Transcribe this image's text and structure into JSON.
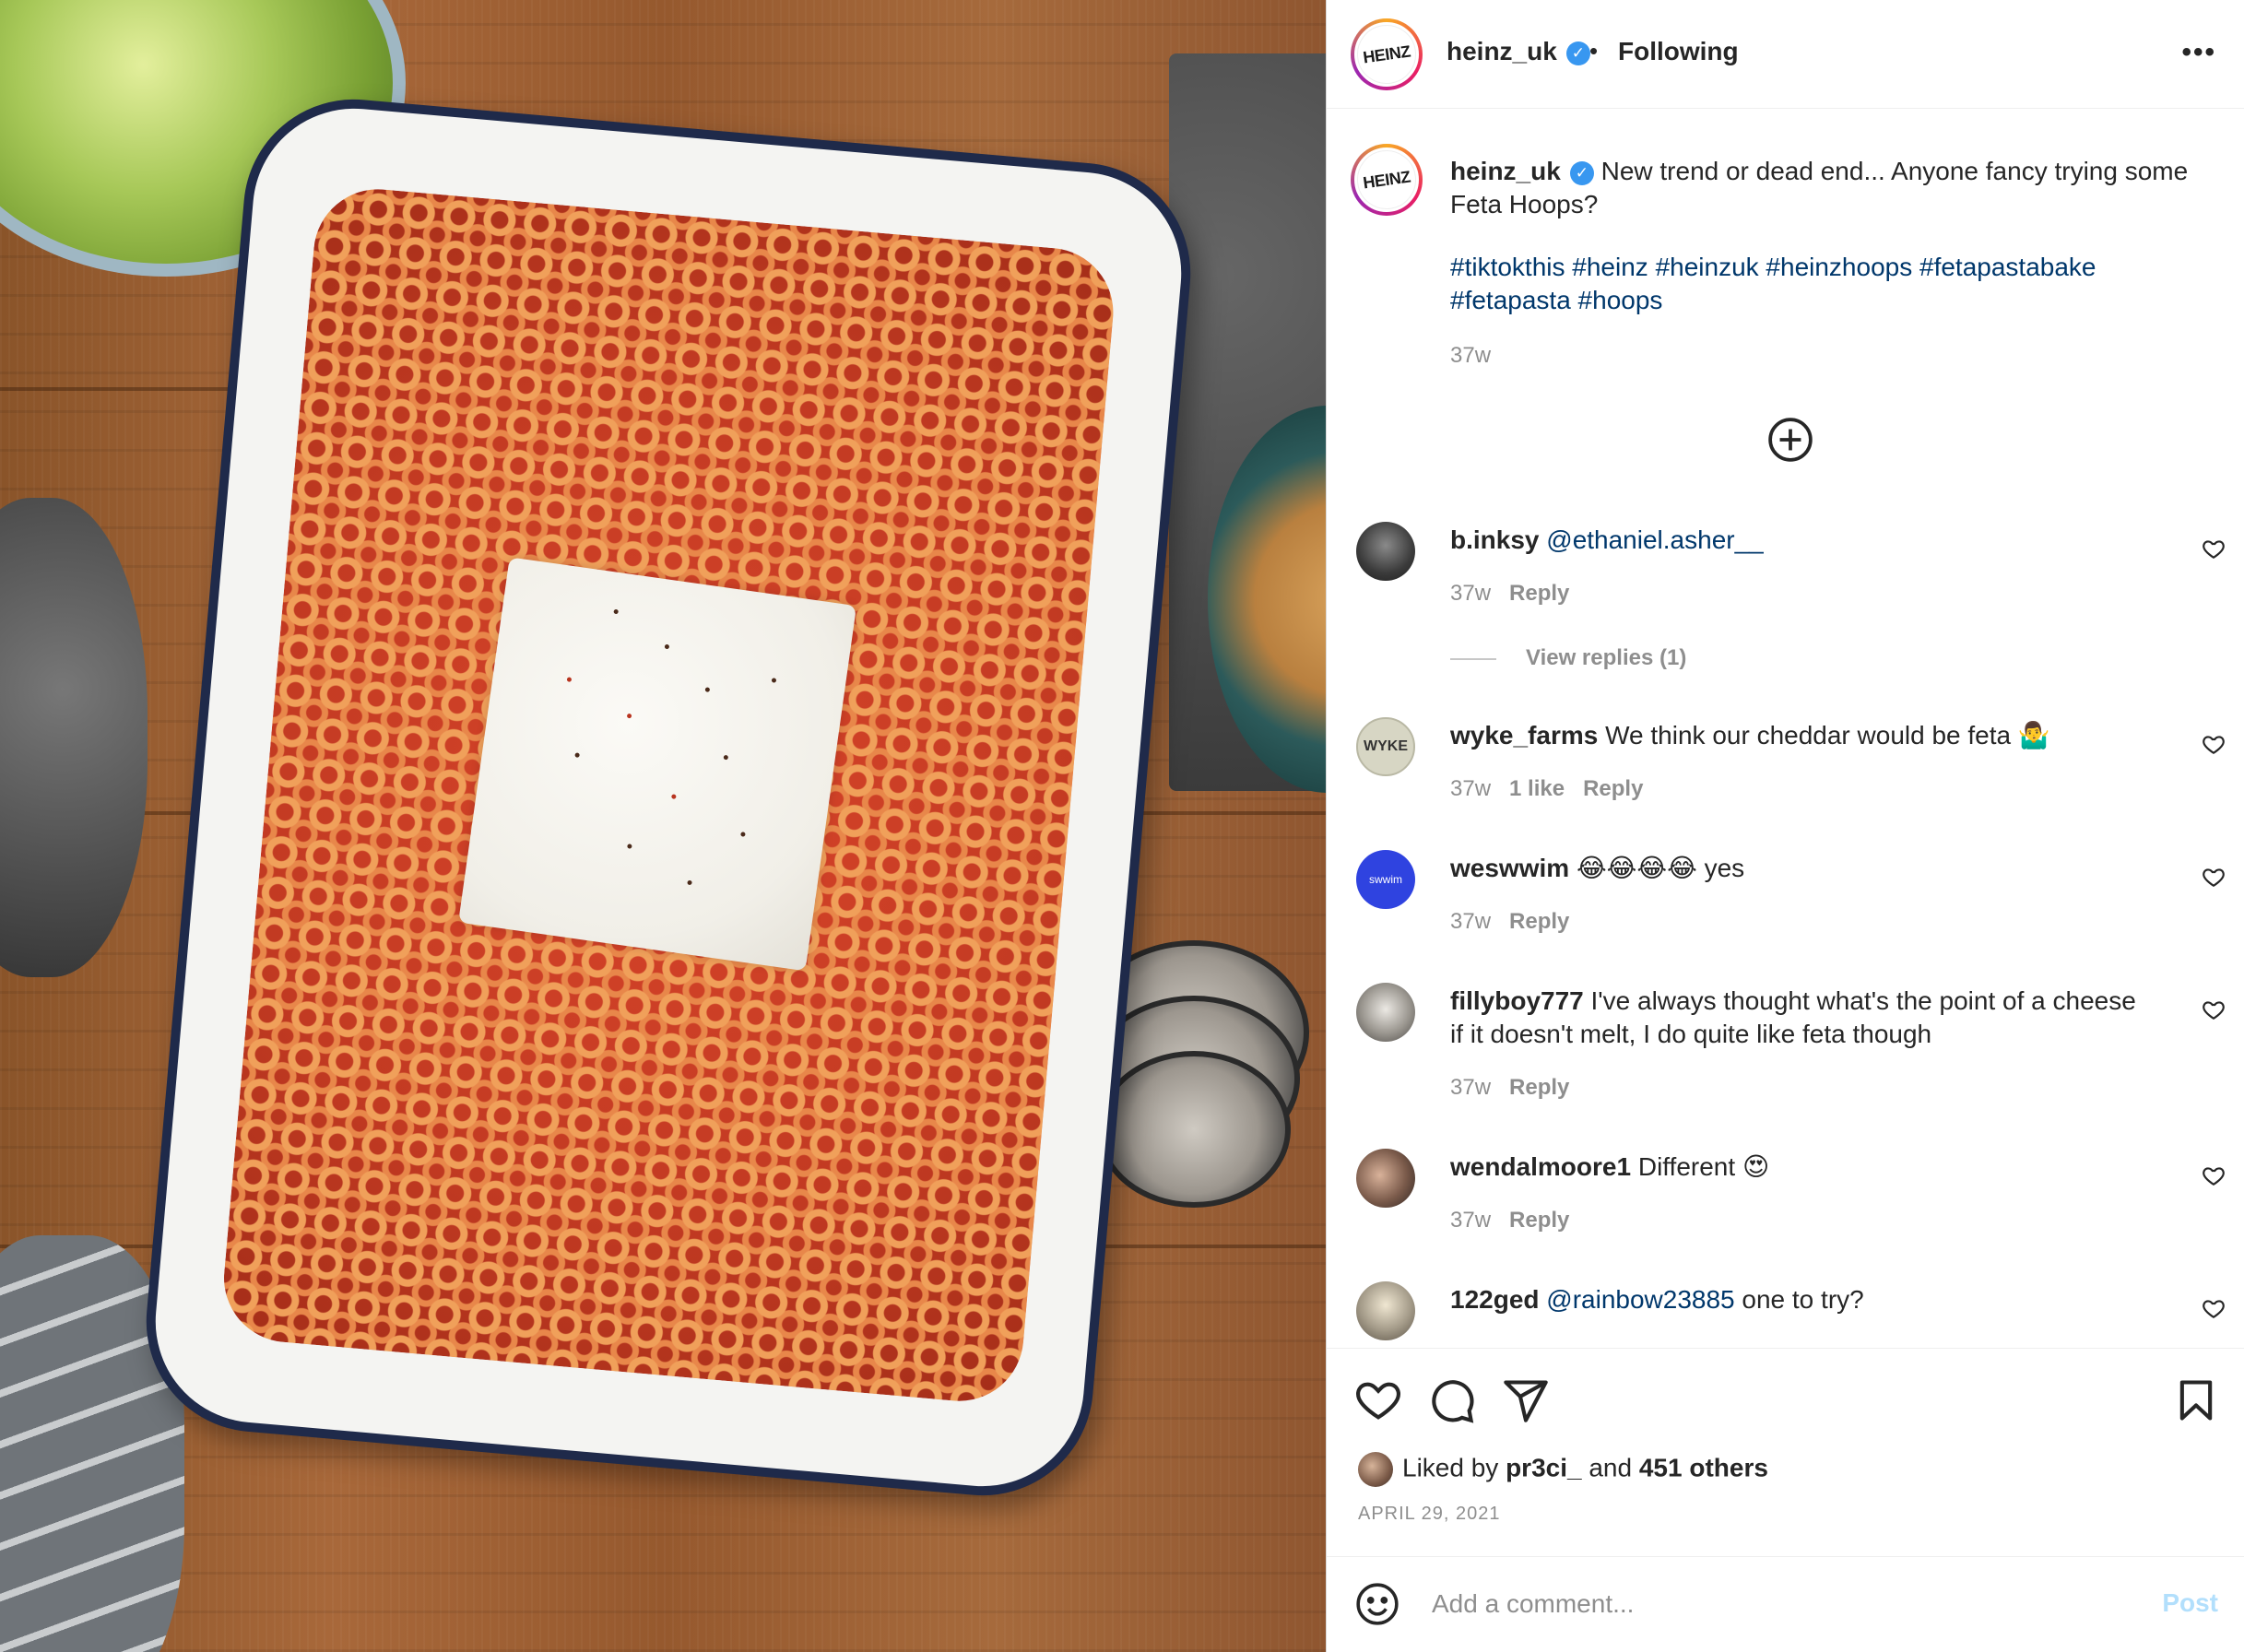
{
  "header": {
    "logo_text": "HEINZ",
    "username": "heinz_uk",
    "verified_mark": "✓",
    "separator": "•",
    "following_label": "Following",
    "more_icon": "more-horizontal-icon"
  },
  "caption": {
    "logo_text": "HEINZ",
    "username": "heinz_uk",
    "verified_mark": "✓",
    "text": "New trend or dead end... Anyone fancy trying some Feta Hoops?",
    "hashtags": "#tiktokthis #heinz #heinzuk #heinzhoops #fetapastabake #fetapasta #hoops",
    "time": "37w"
  },
  "load_more_icon": "plus-circle-icon",
  "comments": [
    {
      "username": "b.inksy",
      "text": "",
      "mention": "@ethaniel.asher__",
      "time": "37w",
      "likes": "",
      "reply": "Reply",
      "view_replies": "View replies (1)",
      "avatar_color": "#3b3b3b"
    },
    {
      "username": "wyke_farms",
      "text": "We think our cheddar would be feta 🤷‍♂️",
      "mention": "",
      "time": "37w",
      "likes": "1 like",
      "reply": "Reply",
      "avatar_text": "WYKE",
      "avatar_color": "#c9c8b4"
    },
    {
      "username": "weswwim",
      "text": "😂😂😂😂 yes",
      "mention": "",
      "time": "37w",
      "likes": "",
      "reply": "Reply",
      "avatar_text": "swwim",
      "avatar_color": "#2f43e0"
    },
    {
      "username": "fillyboy777",
      "text": "I've always thought what's the point of a cheese if it doesn't melt, I do quite like feta though",
      "mention": "",
      "time": "37w",
      "likes": "",
      "reply": "Reply",
      "avatar_color": "#6d6a66"
    },
    {
      "username": "wendalmoore1",
      "text": "Different 😍",
      "mention": "",
      "time": "37w",
      "likes": "",
      "reply": "Reply",
      "avatar_color": "#7a5a4a"
    },
    {
      "username": "122ged",
      "text": "one to try?",
      "mention": "@rainbow23885",
      "time": "",
      "likes": "",
      "reply": "",
      "avatar_color": "#a39a88"
    }
  ],
  "actions": {
    "like_icon": "heart-icon",
    "comment_icon": "comment-icon",
    "share_icon": "send-icon",
    "save_icon": "bookmark-icon",
    "liked_by_prefix": "Liked by",
    "liked_by_user": "pr3ci_",
    "liked_by_and": "and",
    "liked_by_others": "451 others",
    "date": "APRIL 29, 2021"
  },
  "add_comment": {
    "emoji_icon": "emoji-icon",
    "placeholder": "Add a comment...",
    "post_label": "Post"
  },
  "colors": {
    "link": "#00376b",
    "secondary_text": "#8e8e8e",
    "verified": "#3897f0",
    "post_disabled": "#b2dffc"
  }
}
